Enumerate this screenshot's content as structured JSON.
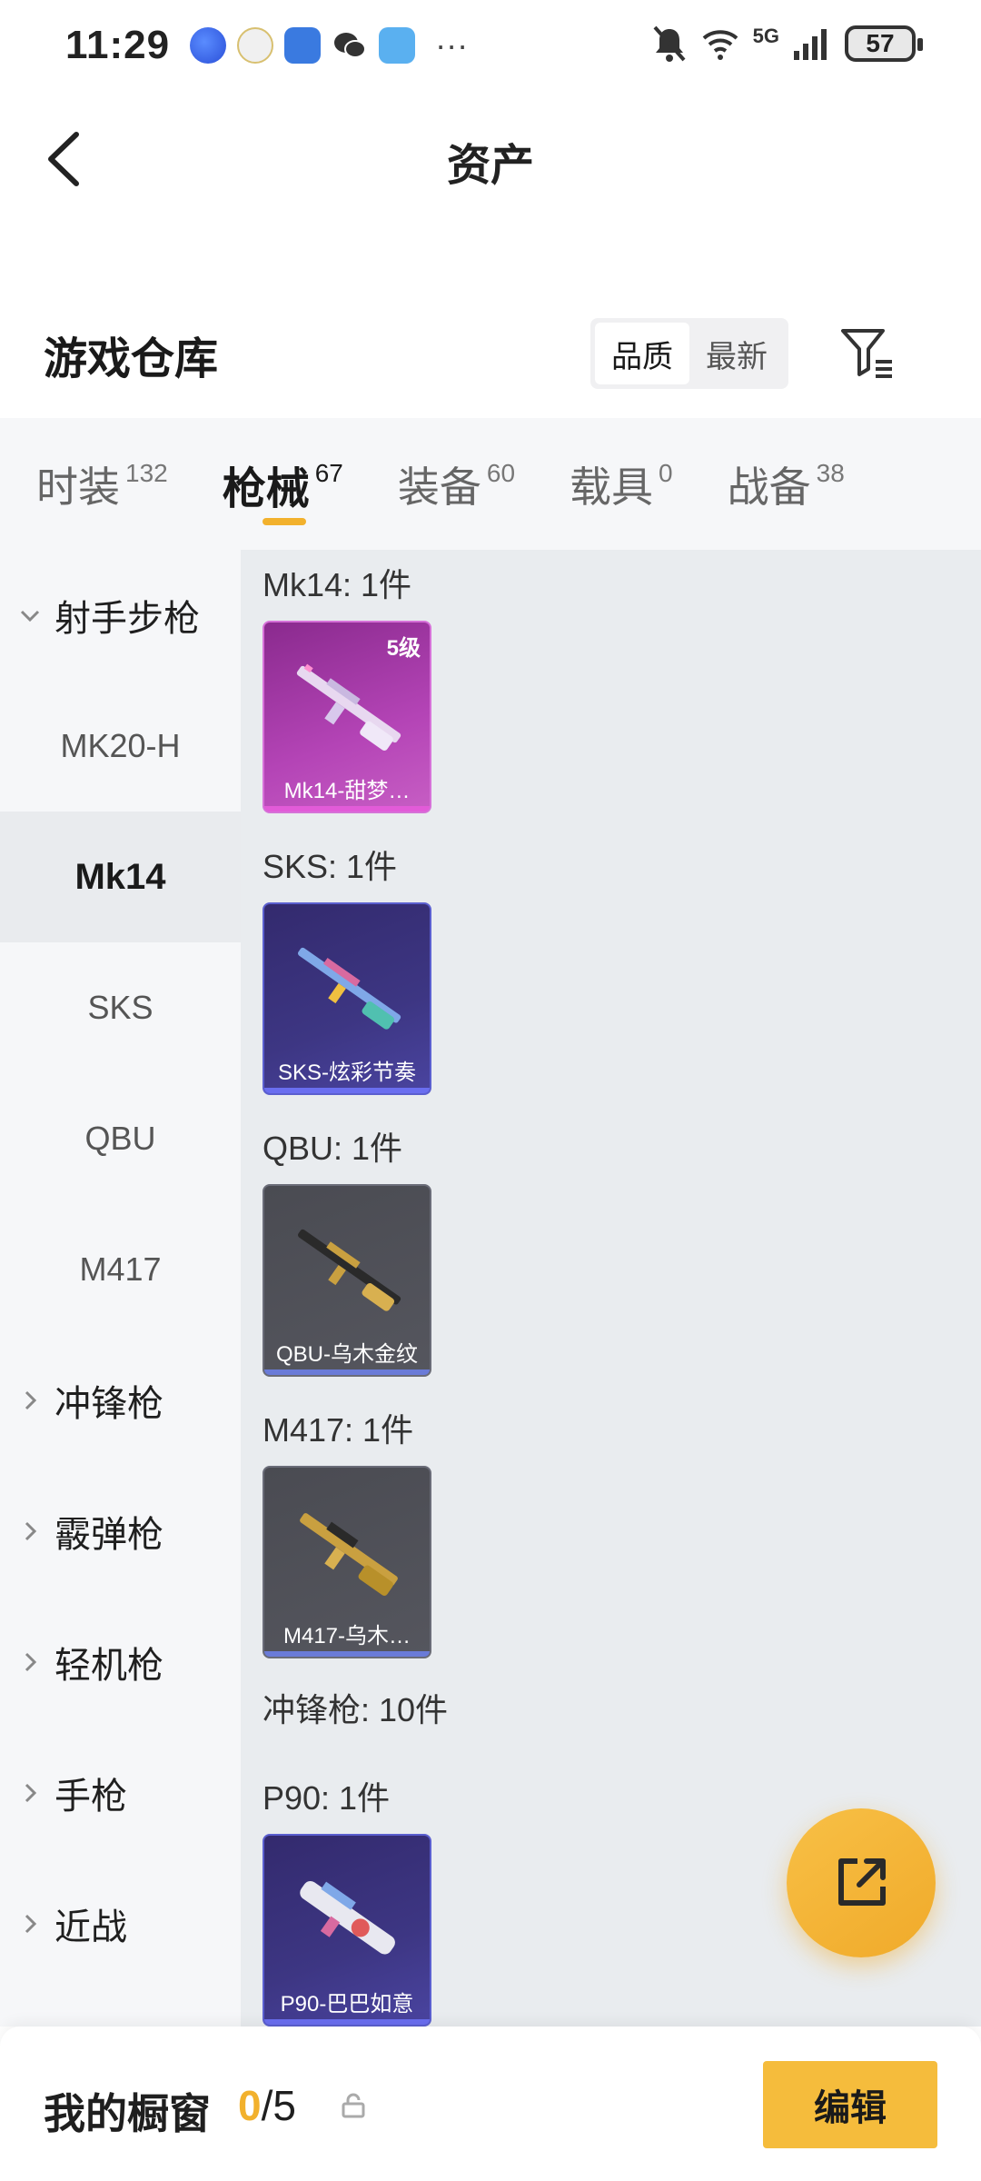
{
  "status_bar": {
    "time": "11:29",
    "more": "···",
    "network": "5G",
    "battery": "57"
  },
  "header": {
    "title": "资产"
  },
  "warehouse": {
    "title": "游戏仓库",
    "sort_options": [
      "品质",
      "最新"
    ],
    "active_sort": "品质"
  },
  "tabs": [
    {
      "label": "时装",
      "count": "132"
    },
    {
      "label": "枪械",
      "count": "67"
    },
    {
      "label": "装备",
      "count": "60"
    },
    {
      "label": "载具",
      "count": "0"
    },
    {
      "label": "战备",
      "count": "38"
    }
  ],
  "active_tab": "枪械",
  "sidebar": {
    "items": [
      {
        "label": "射手步枪",
        "kind": "category",
        "expanded": true
      },
      {
        "label": "MK20-H",
        "kind": "sub"
      },
      {
        "label": "Mk14",
        "kind": "sub",
        "active": true
      },
      {
        "label": "SKS",
        "kind": "sub"
      },
      {
        "label": "QBU",
        "kind": "sub"
      },
      {
        "label": "M417",
        "kind": "sub"
      },
      {
        "label": "冲锋枪",
        "kind": "category",
        "expanded": false
      },
      {
        "label": "霰弹枪",
        "kind": "category",
        "expanded": false
      },
      {
        "label": "轻机枪",
        "kind": "category",
        "expanded": false
      },
      {
        "label": "手枪",
        "kind": "category",
        "expanded": false
      },
      {
        "label": "近战",
        "kind": "category",
        "expanded": false
      }
    ]
  },
  "content": {
    "groups": [
      {
        "label": "Mk14: 1件",
        "card": {
          "name": "Mk14-甜梦…",
          "level": "5级",
          "rarity": "pink"
        }
      },
      {
        "label": "SKS: 1件",
        "card": {
          "name": "SKS-炫彩节奏",
          "rarity": "purple"
        }
      },
      {
        "label": "QBU: 1件",
        "card": {
          "name": "QBU-乌木金纹",
          "rarity": "grey"
        }
      },
      {
        "label": "M417: 1件",
        "card": {
          "name": "M417-乌木…",
          "rarity": "grey"
        }
      },
      {
        "label": "冲锋枪: 10件"
      },
      {
        "label": "P90: 1件",
        "card": {
          "name": "P90-巴巴如意",
          "rarity": "purple"
        }
      }
    ]
  },
  "bottom_bar": {
    "showcase_label": "我的橱窗",
    "showcase_current": "0",
    "showcase_max": "/5",
    "edit_label": "编辑"
  },
  "colors": {
    "accent": "#f2b12d",
    "pink_rarity": "#e25bd8",
    "purple_rarity": "#6a6ef0"
  }
}
